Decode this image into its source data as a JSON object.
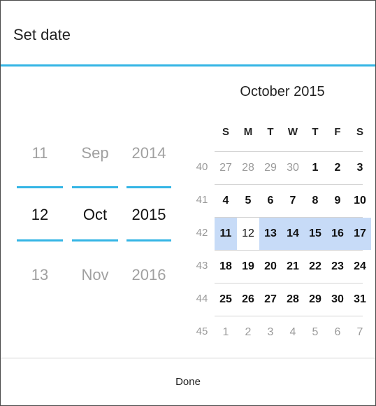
{
  "dialog": {
    "title": "Set date",
    "done_label": "Done"
  },
  "spinners": {
    "day": {
      "prev": "11",
      "current": "12",
      "next": "13"
    },
    "month": {
      "prev": "Sep",
      "current": "Oct",
      "next": "Nov"
    },
    "year": {
      "prev": "2014",
      "current": "2015",
      "next": "2016"
    }
  },
  "calendar": {
    "month_title": "October 2015",
    "weekdays": [
      "S",
      "M",
      "T",
      "W",
      "T",
      "F",
      "S"
    ],
    "selected_day": "12",
    "highlight_color": "#c7dbf7",
    "accent_color": "#34b5e5",
    "weeks": [
      {
        "number": "40",
        "days": [
          "27",
          "28",
          "29",
          "30",
          "1",
          "2",
          "3"
        ]
      },
      {
        "number": "41",
        "days": [
          "4",
          "5",
          "6",
          "7",
          "8",
          "9",
          "10"
        ]
      },
      {
        "number": "42",
        "days": [
          "11",
          "12",
          "13",
          "14",
          "15",
          "16",
          "17"
        ]
      },
      {
        "number": "43",
        "days": [
          "18",
          "19",
          "20",
          "21",
          "22",
          "23",
          "24"
        ]
      },
      {
        "number": "44",
        "days": [
          "25",
          "26",
          "27",
          "28",
          "29",
          "30",
          "31"
        ]
      },
      {
        "number": "45",
        "days": [
          "1",
          "2",
          "3",
          "4",
          "5",
          "6",
          "7"
        ]
      }
    ]
  }
}
